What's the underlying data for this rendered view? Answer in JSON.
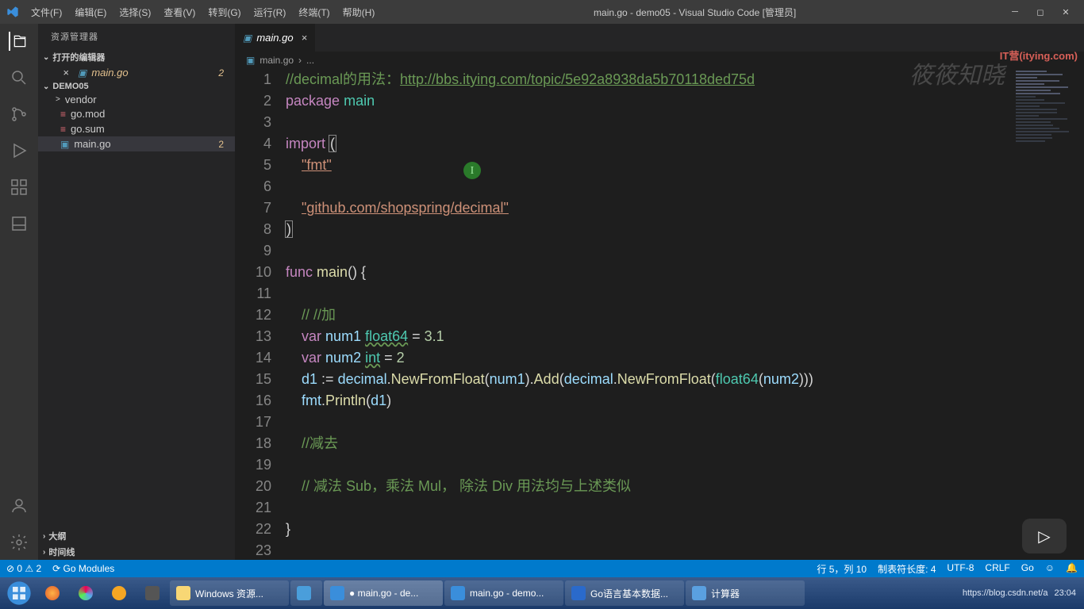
{
  "titlebar": {
    "menus": [
      "文件(F)",
      "编辑(E)",
      "选择(S)",
      "查看(V)",
      "转到(G)",
      "运行(R)",
      "终端(T)",
      "帮助(H)"
    ],
    "title": "main.go - demo05 - Visual Studio Code [管理员]"
  },
  "sidebar": {
    "title": "资源管理器",
    "open_editors_label": "打开的编辑器",
    "open_editors": [
      {
        "name": "main.go",
        "badge": "2"
      }
    ],
    "project": "DEMO05",
    "tree": [
      {
        "type": "folder",
        "name": "vendor",
        "chev": ">"
      },
      {
        "type": "file",
        "name": "go.mod",
        "icon": "mod"
      },
      {
        "type": "file",
        "name": "go.sum",
        "icon": "mod"
      },
      {
        "type": "file",
        "name": "main.go",
        "icon": "go",
        "badge": "2",
        "selected": true
      }
    ],
    "outline_label": "大纲",
    "timeline_label": "时间线"
  },
  "tab": {
    "name": "main.go"
  },
  "breadcrumb": {
    "parts": [
      "main.go",
      "..."
    ]
  },
  "code": {
    "lines": [
      [
        {
          "cls": "cmt",
          "t": "//decimal的用法："
        },
        {
          "cls": "link",
          "t": "http://bbs.itying.com/topic/5e92a8938da5b70118ded75d"
        }
      ],
      [
        {
          "cls": "kw",
          "t": "package"
        },
        {
          "cls": "",
          "t": " "
        },
        {
          "cls": "pkg",
          "t": "main"
        }
      ],
      [],
      [
        {
          "cls": "kw",
          "t": "import"
        },
        {
          "cls": "",
          "t": " "
        },
        {
          "cls": "paren-hl",
          "t": "("
        }
      ],
      [
        {
          "cls": "",
          "t": "    "
        },
        {
          "cls": "str-u",
          "t": "\"fmt\""
        }
      ],
      [],
      [
        {
          "cls": "",
          "t": "    "
        },
        {
          "cls": "str-u",
          "t": "\"github.com/shopspring/decimal\""
        }
      ],
      [
        {
          "cls": "paren-hl",
          "t": ")"
        }
      ],
      [],
      [
        {
          "cls": "kw",
          "t": "func"
        },
        {
          "cls": "",
          "t": " "
        },
        {
          "cls": "fn",
          "t": "main"
        },
        {
          "cls": "",
          "t": "() {"
        }
      ],
      [],
      [
        {
          "cls": "",
          "t": "    "
        },
        {
          "cls": "cmt",
          "t": "// //加"
        }
      ],
      [
        {
          "cls": "",
          "t": "    "
        },
        {
          "cls": "kw",
          "t": "var"
        },
        {
          "cls": "",
          "t": " "
        },
        {
          "cls": "ident",
          "t": "num1"
        },
        {
          "cls": "",
          "t": " "
        },
        {
          "cls": "typ",
          "t": "float64"
        },
        {
          "cls": "",
          "t": " = "
        },
        {
          "cls": "num",
          "t": "3.1"
        }
      ],
      [
        {
          "cls": "",
          "t": "    "
        },
        {
          "cls": "kw",
          "t": "var"
        },
        {
          "cls": "",
          "t": " "
        },
        {
          "cls": "ident",
          "t": "num2"
        },
        {
          "cls": "",
          "t": " "
        },
        {
          "cls": "typ",
          "t": "int"
        },
        {
          "cls": "",
          "t": " = "
        },
        {
          "cls": "num",
          "t": "2"
        }
      ],
      [
        {
          "cls": "",
          "t": "    "
        },
        {
          "cls": "ident",
          "t": "d1"
        },
        {
          "cls": "",
          "t": " := "
        },
        {
          "cls": "ident",
          "t": "decimal"
        },
        {
          "cls": "",
          "t": "."
        },
        {
          "cls": "fn",
          "t": "NewFromFloat"
        },
        {
          "cls": "",
          "t": "("
        },
        {
          "cls": "ident",
          "t": "num1"
        },
        {
          "cls": "",
          "t": ")."
        },
        {
          "cls": "fn",
          "t": "Add"
        },
        {
          "cls": "",
          "t": "("
        },
        {
          "cls": "ident",
          "t": "decimal"
        },
        {
          "cls": "",
          "t": "."
        },
        {
          "cls": "fn",
          "t": "NewFromFloat"
        },
        {
          "cls": "",
          "t": "("
        },
        {
          "cls": "typ2",
          "t": "float64"
        },
        {
          "cls": "",
          "t": "("
        },
        {
          "cls": "ident",
          "t": "num2"
        },
        {
          "cls": "",
          "t": ")))"
        }
      ],
      [
        {
          "cls": "",
          "t": "    "
        },
        {
          "cls": "ident",
          "t": "fmt"
        },
        {
          "cls": "",
          "t": "."
        },
        {
          "cls": "fn",
          "t": "Println"
        },
        {
          "cls": "",
          "t": "("
        },
        {
          "cls": "ident",
          "t": "d1"
        },
        {
          "cls": "",
          "t": ")"
        }
      ],
      [],
      [
        {
          "cls": "",
          "t": "    "
        },
        {
          "cls": "cmt",
          "t": "//减去"
        }
      ],
      [],
      [
        {
          "cls": "",
          "t": "    "
        },
        {
          "cls": "cmt",
          "t": "// 减法 Sub，乘法 Mul， 除法 Div 用法均与上述类似"
        }
      ],
      [],
      [
        {
          "cls": "",
          "t": "}"
        }
      ],
      []
    ]
  },
  "status": {
    "left": [
      "⊘ 0 ⚠ 2",
      "⟳ Go Modules"
    ],
    "right": [
      "行 5，列 10",
      "制表符长度: 4",
      "UTF-8",
      "CRLF",
      "Go",
      "☺",
      "🔔"
    ]
  },
  "taskbar": {
    "apps": [
      {
        "label": "Windows 资源...",
        "color": "#f8d775"
      },
      {
        "label": "",
        "color": "#4a9edb",
        "narrow": true
      },
      {
        "label": "● main.go - de...",
        "color": "#3a8edb",
        "active": true
      },
      {
        "label": "main.go - demo...",
        "color": "#3a8edb"
      },
      {
        "label": "Go语言基本数据...",
        "color": "#2a6acb"
      },
      {
        "label": "计算器",
        "color": "#5aa0e0"
      }
    ],
    "tray_url": "https://blog.csdn.net/a",
    "tray_time": "23:04"
  },
  "watermark": "筱筱知晓",
  "watermark_url": "IT营(itying.com)"
}
